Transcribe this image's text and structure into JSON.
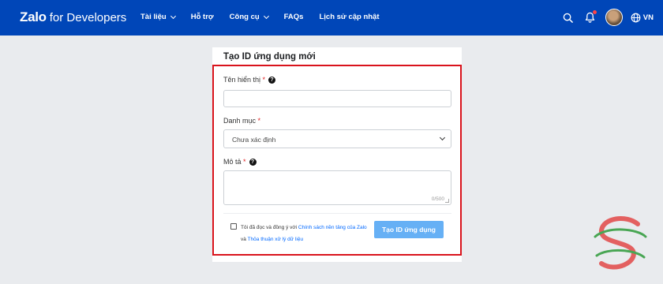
{
  "header": {
    "brand": "Zalo",
    "brand_suffix": "for Developers",
    "nav": [
      {
        "label": "Tài liệu",
        "dropdown": true
      },
      {
        "label": "Hỗ trợ",
        "dropdown": false
      },
      {
        "label": "Công cụ",
        "dropdown": true
      },
      {
        "label": "FAQs",
        "dropdown": false
      },
      {
        "label": "Lịch sử cập nhật",
        "dropdown": false
      }
    ],
    "language": "VN",
    "icons": [
      "search-icon",
      "bell-icon",
      "avatar",
      "globe-icon"
    ],
    "bar_color": "#0046b8"
  },
  "form": {
    "title": "Tạo ID ứng dụng mới",
    "display_name_label": "Tên hiển thị",
    "display_name_value": "",
    "category_label": "Danh mục",
    "category_value": "Chưa xác định",
    "description_label": "Mô tả",
    "description_value": "",
    "description_counter": "0/500",
    "required_mark": "*",
    "help_glyph": "?",
    "terms_prefix": "Tôi đã đọc và đồng ý với",
    "terms_link_1": "Chính sách nền tảng của Zalo",
    "terms_joiner": "và",
    "terms_link_2": "Thỏa thuận xử lý dữ liệu",
    "terms_checked": false,
    "submit_label": "Tạo ID ứng dụng",
    "highlight_color": "#d9131c",
    "button_color": "#66b0f5"
  }
}
